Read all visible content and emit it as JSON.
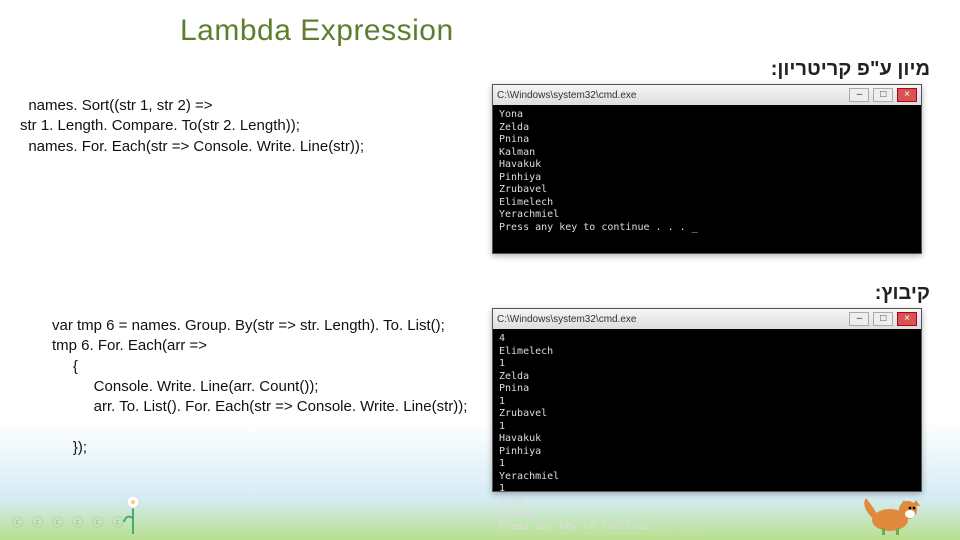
{
  "title": "Lambda Expression",
  "subtitle_sort": "מיון ע\"פ קריטריון:",
  "subtitle_group": "קיבוץ:",
  "code_sort": "  names. Sort((str 1, str 2) =>\nstr 1. Length. Compare. To(str 2. Length));\n  names. For. Each(str => Console. Write. Line(str));",
  "code_group": "var tmp 6 = names. Group. By(str => str. Length). To. List();\ntmp 6. For. Each(arr =>\n     {\n          Console. Write. Line(arr. Count());\n          arr. To. List(). For. Each(str => Console. Write. Line(str));\n\n     });",
  "terminal": {
    "title_text": "C:\\Windows\\system32\\cmd.exe",
    "output_sort": "Yona\nZelda\nPnina\nKalman\nHavakuk\nPinhiya\nZrubavel\nElimelech\nYerachmiel\nPress any key to continue . . . _",
    "output_group": "4\nElimelech\n1\nZelda\nPnina\n1\nZrubavel\n1\nHavakuk\nPinhiya\n1\nYerachmiel\n1\nYona\nKalman\nPress any key to continue . . . _",
    "btn_min": "–",
    "btn_max": "□",
    "btn_close": "×"
  },
  "cc_text": "ⓒ ⓒ ⓒ ⓒ ⓒ ⓒ"
}
